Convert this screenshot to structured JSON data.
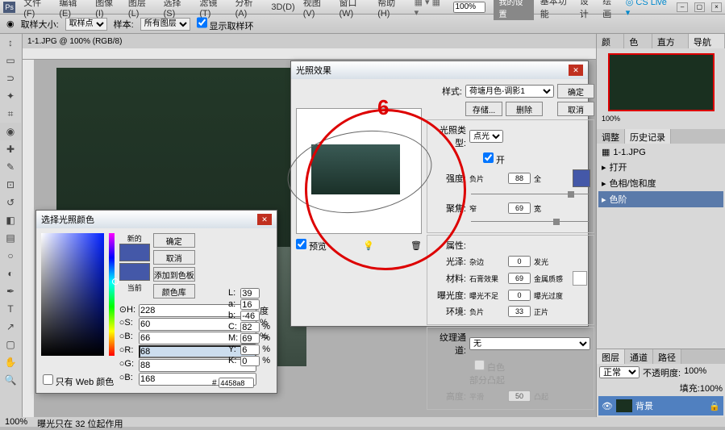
{
  "menu": {
    "logo": "Ps",
    "items": [
      "文件(F)",
      "编辑(E)",
      "图像(I)",
      "图层(L)",
      "选择(S)",
      "滤镜(T)",
      "分析(A)",
      "3D(D)",
      "视图(V)",
      "窗口(W)",
      "帮助(H)"
    ],
    "zoom_combo": "100%",
    "my_settings": "我的设置",
    "basic": "基本功能",
    "design": "设计",
    "paint": "绘画",
    "cslive": "CS Live"
  },
  "optbar": {
    "sample_size_label": "取样大小:",
    "sample_size_value": "取样点",
    "sample_label": "样本:",
    "sample_value": "所有图层",
    "show_ring": "显示取样环"
  },
  "doc": {
    "tab": "1-1.JPG @ 100% (RGB/8)"
  },
  "status": {
    "zoom": "100%",
    "info": "曝光只在 32 位起作用"
  },
  "panels": {
    "nav_tabs": [
      "颜色",
      "色板",
      "直方图",
      "导航器"
    ],
    "nav_pct": "100%",
    "hist_tabs": [
      "调整",
      "历史记录"
    ],
    "history": [
      "1-1.JPG",
      "打开",
      "色相/饱和度",
      "色阶"
    ],
    "layer_tabs": [
      "图层",
      "通道",
      "路径"
    ],
    "blend": "正常",
    "opacity_label": "不透明度:",
    "opacity": "100%",
    "fill_label": "填充:",
    "fill": "100%",
    "layer_name": "背景"
  },
  "lighting": {
    "title": "光照效果",
    "style_label": "样式:",
    "style_value": "荷塘月色-调影1",
    "ok": "确定",
    "save": "存储...",
    "delete": "删除",
    "cancel": "取消",
    "type_label": "光照类型:",
    "type_value": "点光",
    "on": "开",
    "intensity_label": "强度:",
    "intensity_l": "负片",
    "intensity_v": "88",
    "intensity_r": "全",
    "focus_label": "聚焦:",
    "focus_l": "窄",
    "focus_v": "69",
    "focus_r": "宽",
    "props_label": "属性:",
    "gloss_label": "光泽:",
    "gloss_l": "杂边",
    "gloss_v": "0",
    "gloss_r": "发光",
    "material_label": "材料:",
    "material_l": "石膏效果",
    "material_v": "69",
    "material_r": "金属质感",
    "exposure_label": "曝光度:",
    "exposure_l": "曝光不足",
    "exposure_v": "0",
    "exposure_r": "曝光过度",
    "ambience_label": "环境:",
    "ambience_l": "负片",
    "ambience_v": "33",
    "ambience_r": "正片",
    "texchan_label": "纹理通道:",
    "texchan_value": "无",
    "white_high": "白色部分凸起",
    "height_label": "高度:",
    "height_l": "平滑",
    "height_v": "50",
    "height_r": "凸起",
    "preview_chk": "预览",
    "callout": "6"
  },
  "picker": {
    "title": "选择光照颜色",
    "new": "新的",
    "current": "当前",
    "ok": "确定",
    "cancel": "取消",
    "add": "添加到色板",
    "lib": "颜色库",
    "H": "228",
    "S": "60",
    "B": "66",
    "R": "68",
    "G": "88",
    "Bch": "168",
    "L": "39",
    "a": "16",
    "bb": "-46",
    "C": "82",
    "M": "69",
    "Y": "6",
    "K": "0",
    "deg": "度",
    "pct": "%",
    "hex": "4458a8",
    "webonly": "只有 Web 颜色"
  }
}
